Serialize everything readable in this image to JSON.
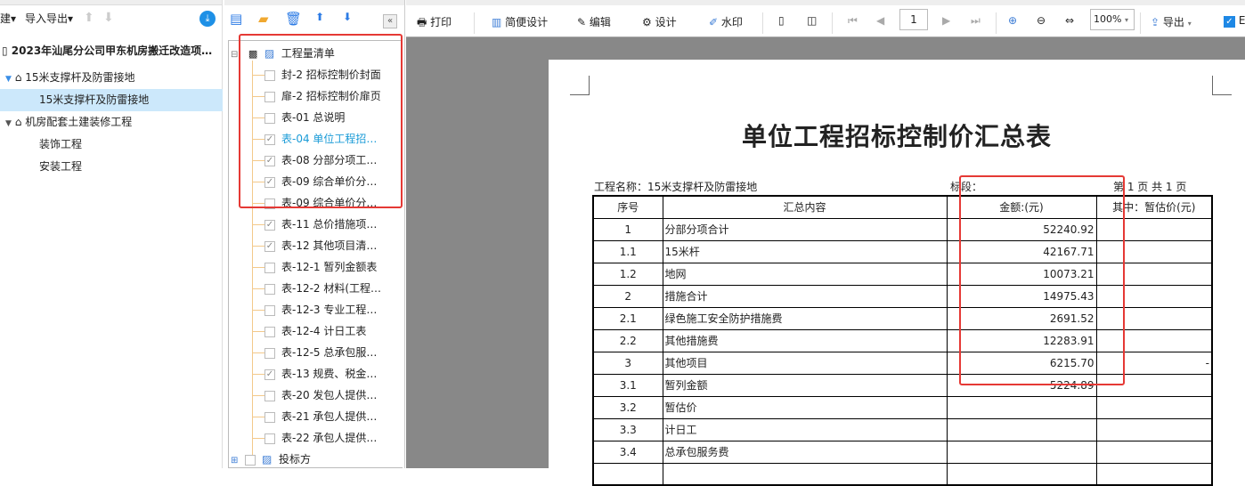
{
  "left": {
    "toolbar": {
      "new": "建",
      "import_export": "导入导出"
    },
    "project": "2023年汕尾分公司甲东机房搬迁改造项…",
    "nodes": [
      {
        "label": "15米支撑杆及防雷接地",
        "level": 1
      },
      {
        "label": "15米支撑杆及防雷接地",
        "level": 2,
        "selected": true
      },
      {
        "label": "机房配套土建装修工程",
        "level": 1
      },
      {
        "label": "装饰工程",
        "level": 2
      },
      {
        "label": "安装工程",
        "level": 2
      }
    ]
  },
  "tree": {
    "root": "工程量清单",
    "items": [
      {
        "label": "封-2 招标控制价封面",
        "checked": false
      },
      {
        "label": "扉-2 招标控制价扉页",
        "checked": false
      },
      {
        "label": "表-01 总说明",
        "checked": false
      },
      {
        "label": "表-04 单位工程招…",
        "checked": true,
        "active": true
      },
      {
        "label": "表-08 分部分项工…",
        "checked": true
      },
      {
        "label": "表-09 综合单价分…",
        "checked": true
      },
      {
        "label": "表-09 综合单价分…",
        "checked": false
      },
      {
        "label": "表-11 总价措施项…",
        "checked": true
      },
      {
        "label": "表-12 其他项目清…",
        "checked": true
      },
      {
        "label": "表-12-1 暂列金额表",
        "checked": false
      },
      {
        "label": "表-12-2 材料(工程…",
        "checked": false
      },
      {
        "label": "表-12-3 专业工程…",
        "checked": false
      },
      {
        "label": "表-12-4 计日工表",
        "checked": false
      },
      {
        "label": "表-12-5 总承包服…",
        "checked": false
      },
      {
        "label": "表-13 规费、税金…",
        "checked": true
      },
      {
        "label": "表-20 发包人提供…",
        "checked": false
      },
      {
        "label": "表-21 承包人提供…",
        "checked": false
      },
      {
        "label": "表-22 承包人提供…",
        "checked": false
      }
    ],
    "bidder": "投标方"
  },
  "toolbar": {
    "print": "打印",
    "simple_design": "简便设计",
    "edit": "编辑",
    "design": "设计",
    "watermark": "水印",
    "page": "1",
    "zoom": "100%",
    "export": "导出",
    "excel": "E"
  },
  "doc": {
    "title": "单位工程招标控制价汇总表",
    "project_name": "工程名称：15米支撑杆及防雷接地",
    "section": "标段：",
    "page_info": "第 1 页  共 1 页",
    "headers": [
      "序号",
      "汇总内容",
      "金额:(元)",
      "其中：暂估价(元)"
    ],
    "rows": [
      [
        "1",
        "分部分项合计",
        "52240.92",
        ""
      ],
      [
        "1.1",
        "15米杆",
        "42167.71",
        ""
      ],
      [
        "1.2",
        "地网",
        "10073.21",
        ""
      ],
      [
        "2",
        "措施合计",
        "14975.43",
        ""
      ],
      [
        "2.1",
        "绿色施工安全防护措施费",
        "2691.52",
        ""
      ],
      [
        "2.2",
        "其他措施费",
        "12283.91",
        ""
      ],
      [
        "3",
        "其他项目",
        "6215.70",
        "-"
      ],
      [
        "3.1",
        "暂列金额",
        "5224.89",
        ""
      ],
      [
        "3.2",
        "暂估价",
        "",
        ""
      ],
      [
        "3.3",
        "计日工",
        "",
        ""
      ],
      [
        "3.4",
        "总承包服务费",
        "",
        ""
      ],
      [
        "",
        "",
        "",
        ""
      ]
    ]
  },
  "colors": {
    "highlight": "#e53935",
    "accent": "#1a9bd7",
    "selected": "#cce8fb"
  }
}
